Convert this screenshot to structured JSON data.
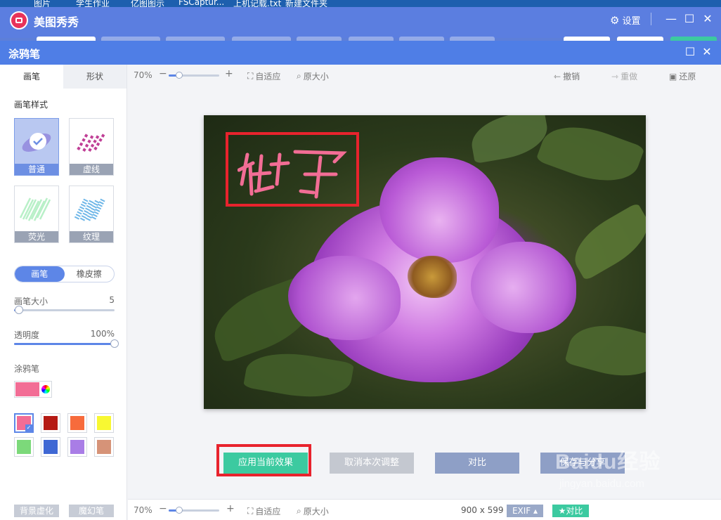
{
  "desktop": {
    "items": [
      "图片",
      "学生作业",
      "亿图图示",
      "FSCaptur...",
      "上机记载.txt",
      "新建文件夹"
    ]
  },
  "app": {
    "title": "美图秀秀",
    "settings_label": "设置"
  },
  "dialog": {
    "title": "涂鸦笔"
  },
  "left_panel": {
    "tabs": [
      "画笔",
      "形状"
    ],
    "brush_style_label": "画笔样式",
    "brushes": [
      {
        "label": "普通",
        "selected": true
      },
      {
        "label": "虚线",
        "selected": false
      },
      {
        "label": "荧光",
        "selected": false
      },
      {
        "label": "纹理",
        "selected": false
      }
    ],
    "modes": [
      "画笔",
      "橡皮擦"
    ],
    "brush_size": {
      "label": "画笔大小",
      "value": "5",
      "fraction": 0.05
    },
    "opacity": {
      "label": "透明度",
      "value": "100%",
      "fraction": 1.0
    },
    "color_label": "涂鸦笔",
    "current_color": "#f26d95",
    "swatches": [
      "#f26d95",
      "#b51a14",
      "#f76b3c",
      "#f8f832",
      "#7cd97a",
      "#3f68d4",
      "#a97de6",
      "#d69378"
    ],
    "ghost_buttons": [
      "背景虚化",
      "魔幻笔"
    ]
  },
  "toolbar": {
    "zoom": "70%",
    "fit_label": "自适应",
    "original_label": "原大小",
    "undo_label": "撤销",
    "redo_label": "重做",
    "restore_label": "还原"
  },
  "canvas": {
    "handwriting": "牡丹"
  },
  "actions": {
    "apply": "应用当前效果",
    "cancel": "取消本次调整",
    "compare": "对比",
    "save": "保存与分享"
  },
  "bottombar": {
    "zoom": "70%",
    "fit_label": "自适应",
    "original_label": "原大小",
    "dimensions": "900 x 599",
    "exif_label": "EXIF",
    "compare_label": "对比"
  },
  "watermark": {
    "brand": "Baidu经验",
    "url": "jingyan.baidu.com"
  }
}
